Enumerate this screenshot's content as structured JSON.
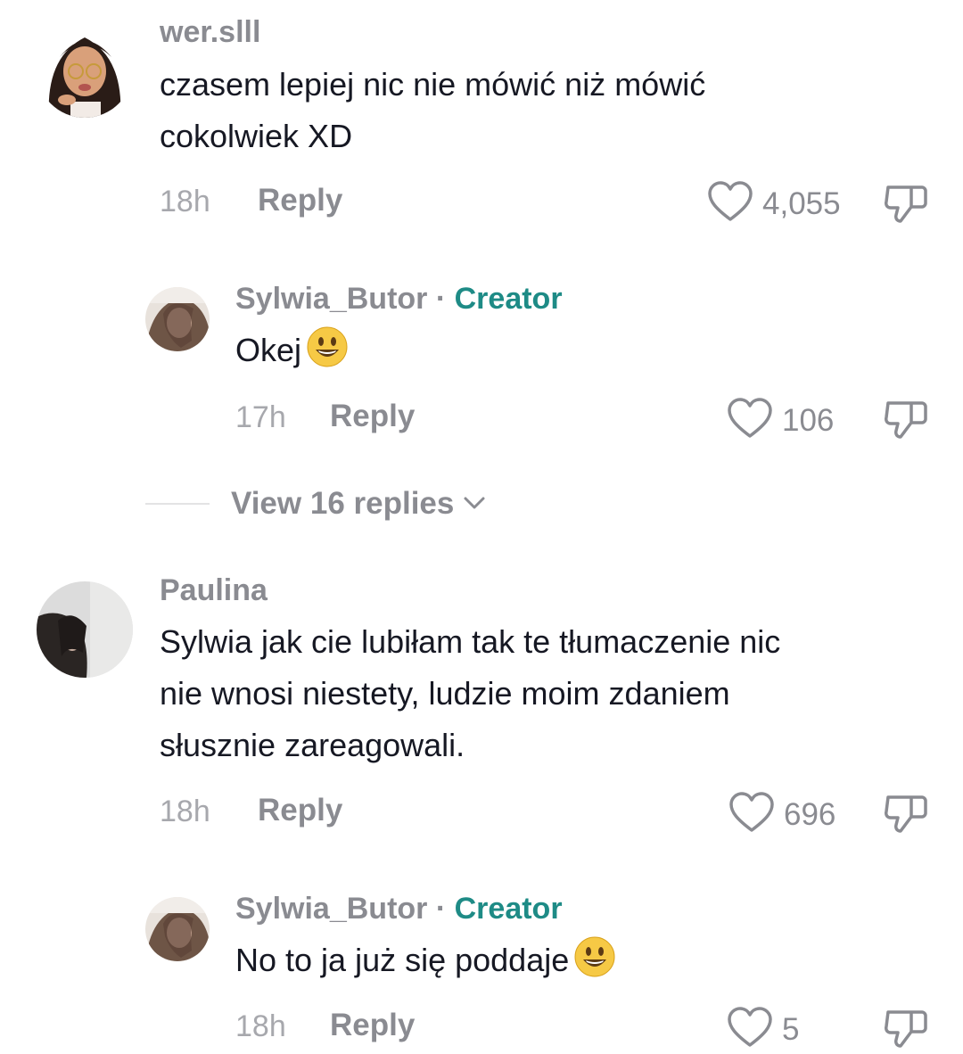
{
  "comments": [
    {
      "username": "wer.slll",
      "text_line1": "czasem lepiej nic nie mówić niż mówić",
      "text_line2": "cokolwiek XD",
      "time": "18h",
      "reply_label": "Reply",
      "likes": "4,055"
    },
    {
      "username": "Sylwia_Butor",
      "creator_separator": "·",
      "creator_label": "Creator",
      "text": "Okej",
      "emoji": "smiley-emoji",
      "time": "17h",
      "reply_label": "Reply",
      "likes": "106"
    },
    {
      "username": "Paulina",
      "text_line1": "Sylwia jak cie lubiłam tak te tłumaczenie nic",
      "text_line2": "nie wnosi niestety, ludzie moim zdaniem",
      "text_line3": "słusznie zareagowali.",
      "time": "18h",
      "reply_label": "Reply",
      "likes": "696"
    },
    {
      "username": "Sylwia_Butor",
      "creator_separator": "·",
      "creator_label": "Creator",
      "text": "No to ja już się poddaje",
      "emoji": "smiley-emoji",
      "time": "18h",
      "reply_label": "Reply",
      "likes": "5"
    }
  ],
  "view_replies": {
    "label": "View 16 replies",
    "icon": "chevron-down-icon"
  },
  "colors": {
    "text": "#161823",
    "secondary": "#8a8b91",
    "time": "#a7a8ad",
    "creator": "#1e8b86"
  }
}
